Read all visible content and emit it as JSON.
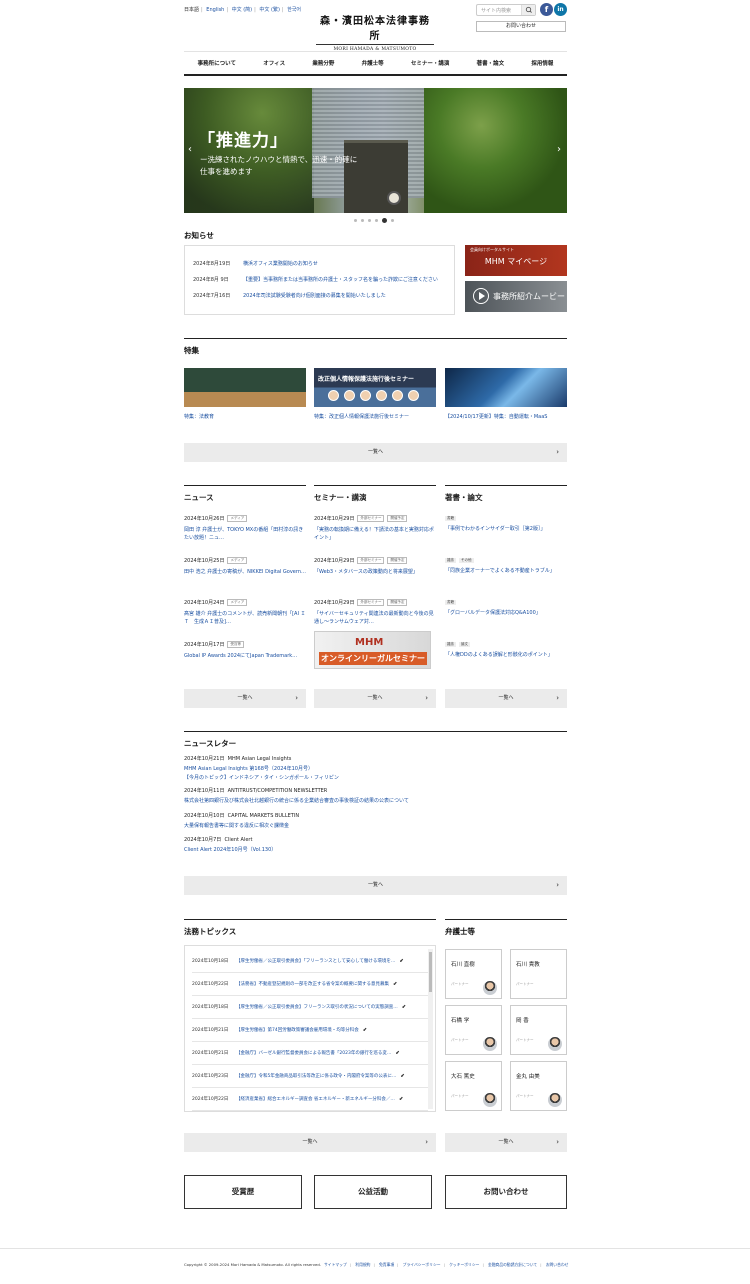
{
  "header": {
    "languages": [
      "日本語",
      "English",
      "中文 (简)",
      "中文 (繁)",
      "한국어"
    ],
    "logo_jp": "森・濱田松本法律事務所",
    "logo_en": "MORI HAMADA & MATSUMOTO",
    "search_placeholder": "サイト内検索",
    "contact_label": "お問い合わせ",
    "facebook": "f",
    "linkedin": "in"
  },
  "nav": [
    "事務所について",
    "オフィス",
    "業務分野",
    "弁護士等",
    "セミナー・講演",
    "著書・論文",
    "採用情報"
  ],
  "hero": {
    "headline": "「推進力」",
    "line1": "ー洗練されたノウハウと情熱で、迅速・的確に",
    "line2": "仕事を進めます",
    "prev": "‹",
    "next": "›"
  },
  "notices": {
    "title": "お知らせ",
    "items": [
      {
        "date": "2024年8月19日",
        "text": "横浜オフィス業務開始のお知らせ"
      },
      {
        "date": "2024年8月 9日",
        "text": "【重要】当事務所または当事務所の弁護士・スタッフ名を騙った詐欺にご注意ください"
      },
      {
        "date": "2024年7月16日",
        "text": "2024年司法試験受験者向け個別面接の募集を開始いたしました"
      }
    ]
  },
  "portal": {
    "small": "会員向けポータルサイト",
    "title": "MHM マイページ"
  },
  "movie": {
    "title": "事務所紹介ムービー"
  },
  "features": {
    "title": "特集",
    "banner": "改正個人情報保護法施行後セミナー",
    "items": [
      "特集：法教育",
      "特集：改正個人情報保護法施行後セミナー",
      "【2024/10/17更新】特集：自動運転・MaaS"
    ],
    "more": "一覧へ"
  },
  "news": {
    "title": "ニュース",
    "items": [
      {
        "date": "2024年10月26日",
        "tag": "メディア",
        "text": "岡田 淳 弁護士が、TOKYO MXの番組「田村淳の訊きたい放題！ニュ…"
      },
      {
        "date": "2024年10月25日",
        "tag": "メディア",
        "text": "田中 浩之 弁護士の寄稿が、NIKKEI Digital Govern…"
      },
      {
        "date": "2024年10月24日",
        "tag": "メディア",
        "text": "髙宮 雄介 弁護士のコメントが、読売新聞朝刊「[AI ＩＴ　生成ＡＩ普及]…"
      },
      {
        "date": "2024年10月17日",
        "tag": "受賞等",
        "text": "Global IP Awards 2024にてJapan Trademark…"
      }
    ],
    "more": "一覧へ"
  },
  "seminars": {
    "title": "セミナー・講演",
    "items": [
      {
        "date": "2024年10月29日",
        "tag1": "外部セミナー",
        "tag2": "開催予定",
        "text": "「実務の転換期に備える！下請法の基本と実務対応ポイント」"
      },
      {
        "date": "2024年10月29日",
        "tag1": "外部セミナー",
        "tag2": "開催予定",
        "text": "「Web3・メタバースの政策動向と将来展望」"
      },
      {
        "date": "2024年10月29日",
        "tag1": "外部セミナー",
        "tag2": "開催予定",
        "text": "「サイバーセキュリティ関連法の最新動向と今後の見通し～ランサムウェア対…"
      }
    ],
    "banner_top": "MHM",
    "banner_bottom": "オンラインリーガルセミナー",
    "more": "一覧へ"
  },
  "publications": {
    "title": "著書・論文",
    "items": [
      {
        "tags": [
          "書籍"
        ],
        "text": "「事例でわかるインサイダー取引［第2版］」"
      },
      {
        "tags": [
          "雑誌",
          "その他"
        ],
        "text": "「同族企業オーナーでよくある不動産トラブル」"
      },
      {
        "tags": [
          "書籍"
        ],
        "text": "「グローバルデータ保護法対応Q&A100」"
      },
      {
        "tags": [
          "雑誌",
          "論文"
        ],
        "text": "「人権DDのよくある誤解と形骸化のポイント」"
      }
    ],
    "more": "一覧へ"
  },
  "newsletter": {
    "title": "ニュースレター",
    "items": [
      {
        "date": "2024年10月21日",
        "name": "MHM Asian Legal Insights",
        "links": [
          "MHM Asian Legal Insights 第168号（2024年10月号）",
          "【今月のトピック】インドネシア・タイ・シンガポール・フィリピン"
        ]
      },
      {
        "date": "2024年10月11日",
        "name": "ANTITRUST/COMPETITION NEWSLETTER",
        "links": [
          "株式会社第四銀行及び株式会社北越銀行の統合に係る企業結合審査の事後検証の結果の公表について"
        ]
      },
      {
        "date": "2024年10月10日",
        "name": "CAPITAL MARKETS BULLETIN",
        "links": [
          "大量保有報告書等に関する違反に相次ぐ課徴金"
        ]
      },
      {
        "date": "2024年10月7日",
        "name": "Client Alert",
        "links": [
          "Client Alert 2024年10月号（Vol.130）"
        ]
      }
    ],
    "more": "一覧へ"
  },
  "legal_topics": {
    "title": "法務トピックス",
    "items": [
      {
        "date": "2024年10月18日",
        "text": "【厚生労働省／公正取引委員会】「フリーランスとして安心して働ける環境を…"
      },
      {
        "date": "2024年10月22日",
        "text": "【法務省】不動産登記規則の一部を改正する省令案の概要に関する意見募集"
      },
      {
        "date": "2024年10月18日",
        "text": "【厚生労働省／公正取引委員会】フリーランス取引の状況についての実態調査…"
      },
      {
        "date": "2024年10月21日",
        "text": "【厚生労働省】第74回労働政策審議会雇用環境・均等分科会"
      },
      {
        "date": "2024年10月21日",
        "text": "【金融庁】バーゼル銀行監督委員会による報告書「2023年の銀行を巡る変…"
      },
      {
        "date": "2024年10月23日",
        "text": "【金融庁】令和5年金融商品取引法等改正に係る政令・内閣府令案等の公表に…"
      },
      {
        "date": "2024年10月22日",
        "text": "【経済産業省】総合エネルギー調査会 省エネルギー・新エネルギー分科会／…"
      }
    ],
    "more": "一覧へ"
  },
  "lawyers": {
    "title": "弁護士等",
    "items": [
      {
        "name": "石川 直樹",
        "role": "パートナー"
      },
      {
        "name": "石川 貴教",
        "role": "パートナー"
      },
      {
        "name": "石橋 学",
        "role": "パートナー"
      },
      {
        "name": "岡 香",
        "role": "パートナー"
      },
      {
        "name": "大石 篤史",
        "role": "パートナー"
      },
      {
        "name": "金丸 由美",
        "role": "パートナー"
      }
    ],
    "more": "一覧へ"
  },
  "bottom_links": [
    "受賞歴",
    "公益活動",
    "お問い合わせ"
  ],
  "footer": {
    "copyright": "Copyright © 2009-2024 Mori Hamada & Matsumoto. All rights reserved.",
    "links": [
      "サイトマップ",
      "利用規約",
      "免責事項",
      "プライバシーポリシー",
      "クッキーポリシー",
      "金融商品の勧誘方針について",
      "お問い合わせ"
    ]
  },
  "colors": {
    "link": "#1a4fa0",
    "portal": "#b2361e",
    "button_bg": "#ebebeb"
  }
}
